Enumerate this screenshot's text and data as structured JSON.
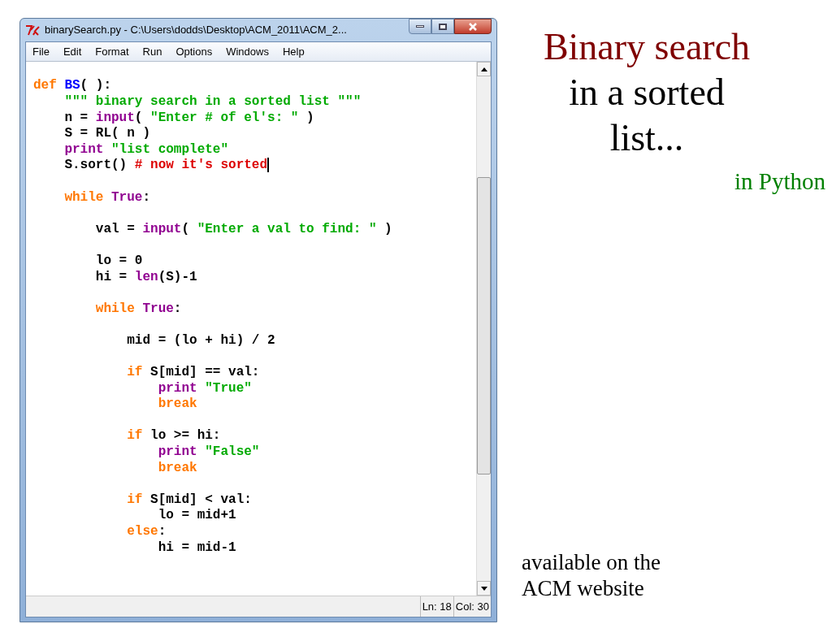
{
  "window": {
    "title": "binarySearch.py - C:\\Users\\dodds\\Desktop\\ACM_2011\\ACM_2...",
    "menu": [
      "File",
      "Edit",
      "Format",
      "Run",
      "Options",
      "Windows",
      "Help"
    ],
    "code": [
      {
        "kind": "blank"
      },
      {
        "kind": "code",
        "cursor": false,
        "tokens": [
          {
            "kind": "keyword",
            "text": "def "
          },
          {
            "kind": "name",
            "text": "BS"
          },
          {
            "kind": "plain",
            "text": "( ):"
          }
        ]
      },
      {
        "kind": "code",
        "cursor": false,
        "tokens": [
          {
            "kind": "string",
            "text": "    \"\"\" binary search in a sorted list \"\"\""
          }
        ]
      },
      {
        "kind": "code",
        "cursor": false,
        "tokens": [
          {
            "kind": "plain",
            "text": "    n = "
          },
          {
            "kind": "builtin",
            "text": "input"
          },
          {
            "kind": "plain",
            "text": "( "
          },
          {
            "kind": "string",
            "text": "\"Enter # of el's: \""
          },
          {
            "kind": "plain",
            "text": " )"
          }
        ]
      },
      {
        "kind": "code",
        "cursor": false,
        "tokens": [
          {
            "kind": "plain",
            "text": "    S = RL( n )"
          }
        ]
      },
      {
        "kind": "code",
        "cursor": false,
        "tokens": [
          {
            "kind": "builtin",
            "text": "    print "
          },
          {
            "kind": "string",
            "text": "\"list complete\""
          }
        ]
      },
      {
        "kind": "code",
        "cursor": true,
        "tokens": [
          {
            "kind": "plain",
            "text": "    S.sort() "
          },
          {
            "kind": "comment",
            "text": "# now it's sorted"
          }
        ]
      },
      {
        "kind": "blank"
      },
      {
        "kind": "code",
        "cursor": false,
        "tokens": [
          {
            "kind": "keyword",
            "text": "    while "
          },
          {
            "kind": "builtin",
            "text": "True"
          },
          {
            "kind": "plain",
            "text": ":"
          }
        ]
      },
      {
        "kind": "blank"
      },
      {
        "kind": "code",
        "cursor": false,
        "tokens": [
          {
            "kind": "plain",
            "text": "        val = "
          },
          {
            "kind": "builtin",
            "text": "input"
          },
          {
            "kind": "plain",
            "text": "( "
          },
          {
            "kind": "string",
            "text": "\"Enter a val to find: \""
          },
          {
            "kind": "plain",
            "text": " )"
          }
        ]
      },
      {
        "kind": "blank"
      },
      {
        "kind": "code",
        "cursor": false,
        "tokens": [
          {
            "kind": "plain",
            "text": "        lo = 0"
          }
        ]
      },
      {
        "kind": "code",
        "cursor": false,
        "tokens": [
          {
            "kind": "plain",
            "text": "        hi = "
          },
          {
            "kind": "builtin",
            "text": "len"
          },
          {
            "kind": "plain",
            "text": "(S)-1"
          }
        ]
      },
      {
        "kind": "blank"
      },
      {
        "kind": "code",
        "cursor": false,
        "tokens": [
          {
            "kind": "keyword",
            "text": "        while "
          },
          {
            "kind": "builtin",
            "text": "True"
          },
          {
            "kind": "plain",
            "text": ":"
          }
        ]
      },
      {
        "kind": "blank"
      },
      {
        "kind": "code",
        "cursor": false,
        "tokens": [
          {
            "kind": "plain",
            "text": "            mid = (lo + hi) / 2"
          }
        ]
      },
      {
        "kind": "blank"
      },
      {
        "kind": "code",
        "cursor": false,
        "tokens": [
          {
            "kind": "keyword",
            "text": "            if "
          },
          {
            "kind": "plain",
            "text": "S[mid] == val:"
          }
        ]
      },
      {
        "kind": "code",
        "cursor": false,
        "tokens": [
          {
            "kind": "builtin",
            "text": "                print "
          },
          {
            "kind": "string",
            "text": "\"True\""
          }
        ]
      },
      {
        "kind": "code",
        "cursor": false,
        "tokens": [
          {
            "kind": "keyword",
            "text": "                break"
          }
        ]
      },
      {
        "kind": "blank"
      },
      {
        "kind": "code",
        "cursor": false,
        "tokens": [
          {
            "kind": "keyword",
            "text": "            if "
          },
          {
            "kind": "plain",
            "text": "lo >= hi:"
          }
        ]
      },
      {
        "kind": "code",
        "cursor": false,
        "tokens": [
          {
            "kind": "builtin",
            "text": "                print "
          },
          {
            "kind": "string",
            "text": "\"False\""
          }
        ]
      },
      {
        "kind": "code",
        "cursor": false,
        "tokens": [
          {
            "kind": "keyword",
            "text": "                break"
          }
        ]
      },
      {
        "kind": "blank"
      },
      {
        "kind": "code",
        "cursor": false,
        "tokens": [
          {
            "kind": "keyword",
            "text": "            if "
          },
          {
            "kind": "plain",
            "text": "S[mid] < val:"
          }
        ]
      },
      {
        "kind": "code",
        "cursor": false,
        "tokens": [
          {
            "kind": "plain",
            "text": "                lo = mid+1"
          }
        ]
      },
      {
        "kind": "code",
        "cursor": false,
        "tokens": [
          {
            "kind": "keyword",
            "text": "            else"
          },
          {
            "kind": "plain",
            "text": ":"
          }
        ]
      },
      {
        "kind": "code",
        "cursor": false,
        "tokens": [
          {
            "kind": "plain",
            "text": "                hi = mid-1"
          }
        ]
      }
    ],
    "status_bar": {
      "line": "Ln: 18",
      "column": "Col: 30"
    }
  },
  "slide": {
    "title": "Binary search",
    "subtitle_lines": [
      "in a sorted",
      "list..."
    ],
    "language": "in Python",
    "note_lines": [
      "available on the",
      "ACM website"
    ]
  }
}
